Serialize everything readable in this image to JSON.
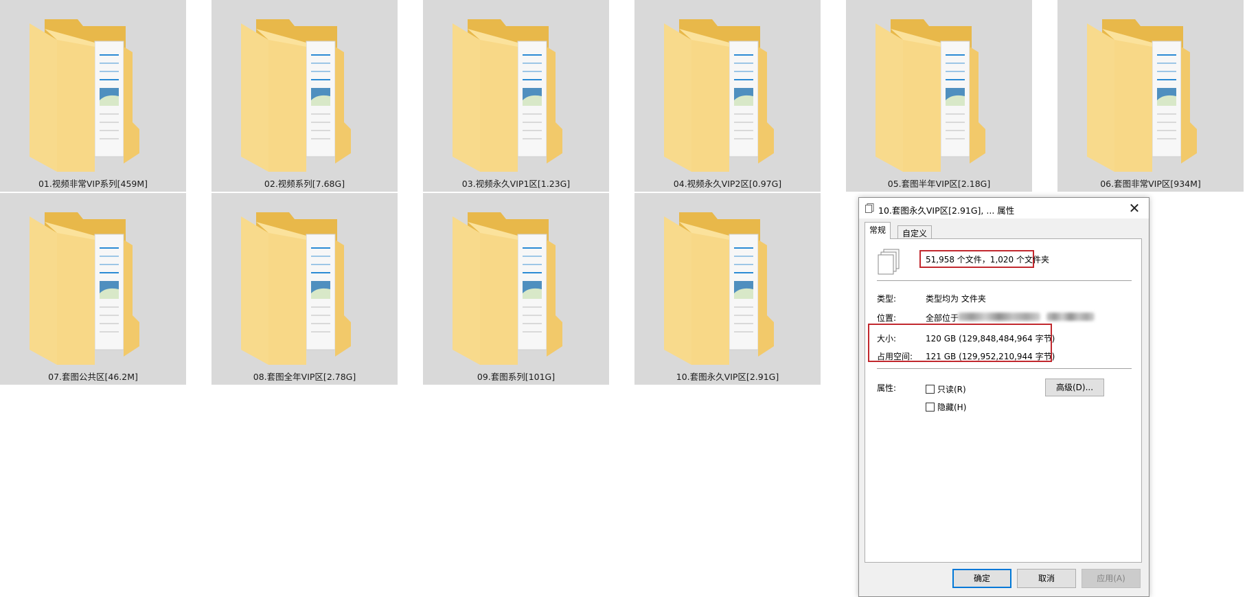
{
  "folders": [
    {
      "name": "01.视频非常VIP系列[459M]"
    },
    {
      "name": "02.视频系列[7.68G]"
    },
    {
      "name": "03.视频永久VIP1区[1.23G]"
    },
    {
      "name": "04.视频永久VIP2区[0.97G]"
    },
    {
      "name": "05.套图半年VIP区[2.18G]"
    },
    {
      "name": "06.套图非常VIP区[934M]"
    },
    {
      "name": "07.套图公共区[46.2M]"
    },
    {
      "name": "08.套图全年VIP区[2.78G]"
    },
    {
      "name": "09.套图系列[101G]"
    },
    {
      "name": "10.套图永久VIP区[2.91G]"
    }
  ],
  "dialog": {
    "title": "10.套图永久VIP区[2.91G], ... 属性",
    "tabs": [
      "常规",
      "自定义"
    ],
    "file_count": "51,958 个文件，1,020 个文件夹",
    "type_label": "类型:",
    "type_value": "类型均为 文件夹",
    "location_label": "位置:",
    "location_value": "全部位于",
    "size_label": "大小:",
    "size_value": "120 GB (129,848,484,964 字节)",
    "disk_label": "占用空间:",
    "disk_value": "121 GB (129,952,210,944 字节)",
    "attr_label": "属性:",
    "readonly_label": "只读(R)",
    "hidden_label": "隐藏(H)",
    "advanced_button": "高级(D)...",
    "ok_button": "确定",
    "cancel_button": "取消",
    "apply_button": "应用(A)"
  },
  "colors": {
    "folder_bg": "#d9d9d9",
    "highlight_red": "#c1272d",
    "accent_blue": "#0078d7"
  },
  "icons": {
    "folder": "folder-with-documents-icon",
    "dialog_title": "files-small-icon",
    "file_stack": "file-stack-icon",
    "close": "close-icon"
  }
}
